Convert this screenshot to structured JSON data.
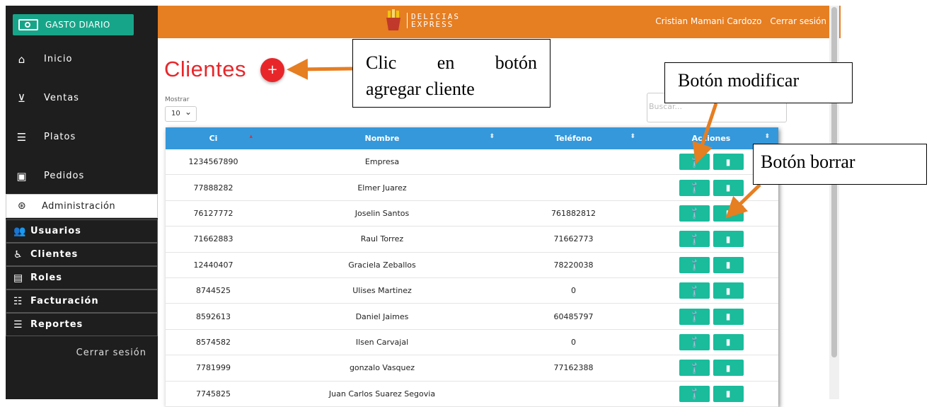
{
  "sidebar": {
    "brand": "GASTO DIARIO",
    "nav": [
      {
        "label": "Inicio",
        "icon": "home-icon"
      },
      {
        "label": "Ventas",
        "icon": "cart-icon"
      },
      {
        "label": "Platos",
        "icon": "platter-icon"
      },
      {
        "label": "Pedidos",
        "icon": "menu-icon"
      }
    ],
    "admin": {
      "label": "Administración",
      "icon": "admin-icon"
    },
    "sub": [
      {
        "label": "Usuarios",
        "icon": "users-icon"
      },
      {
        "label": "Clientes",
        "icon": "clients-icon"
      },
      {
        "label": "Roles",
        "icon": "roles-icon"
      },
      {
        "label": "Facturación",
        "icon": "billing-icon"
      },
      {
        "label": "Reportes",
        "icon": "reports-icon"
      }
    ],
    "logout": "Cerrar sesión"
  },
  "topbar": {
    "logo_line1": "DELICIAS",
    "logo_line2": "EXPRESS",
    "user_name": "Cristian Mamani Cardozo",
    "logout": "Cerrar sesión"
  },
  "page": {
    "title": "Clientes",
    "add_label": "+",
    "show_label": "Mostrar",
    "show_value": "10",
    "search_placeholder": "Buscar..."
  },
  "table": {
    "headers": [
      "Ci",
      "Nombre",
      "Teléfono",
      "Acciones"
    ],
    "rows": [
      {
        "ci": "1234567890",
        "nombre": "Empresa",
        "telefono": ""
      },
      {
        "ci": "77888282",
        "nombre": "Elmer Juarez",
        "telefono": ""
      },
      {
        "ci": "76127772",
        "nombre": "Joselin Santos",
        "telefono": "761882812"
      },
      {
        "ci": "71662883",
        "nombre": "Raul Torrez",
        "telefono": "71662773"
      },
      {
        "ci": "12440407",
        "nombre": "Graciela Zeballos",
        "telefono": "78220038"
      },
      {
        "ci": "8744525",
        "nombre": "Ulises Martinez",
        "telefono": "0"
      },
      {
        "ci": "8592613",
        "nombre": "Daniel Jaimes",
        "telefono": "60485797"
      },
      {
        "ci": "8574582",
        "nombre": "Ilsen Carvajal",
        "telefono": "0"
      },
      {
        "ci": "7781999",
        "nombre": "gonzalo Vasquez",
        "telefono": "77162388"
      },
      {
        "ci": "7745825",
        "nombre": "Juan Carlos Suarez Segovia",
        "telefono": ""
      }
    ]
  },
  "annotations": {
    "add_client_l1_a": "Clic",
    "add_client_l1_b": "en",
    "add_client_l1_c": "botón",
    "add_client_l2": "agregar cliente",
    "modify": "Botón modificar",
    "delete": "Botón borrar"
  },
  "colors": {
    "topbar": "#e67e22",
    "brand": "#17a589",
    "sidebar": "#1e1e1e",
    "title": "#e8262a",
    "table_header": "#3498db",
    "action_button": "#1abc9c",
    "arrow": "#e67e22"
  }
}
